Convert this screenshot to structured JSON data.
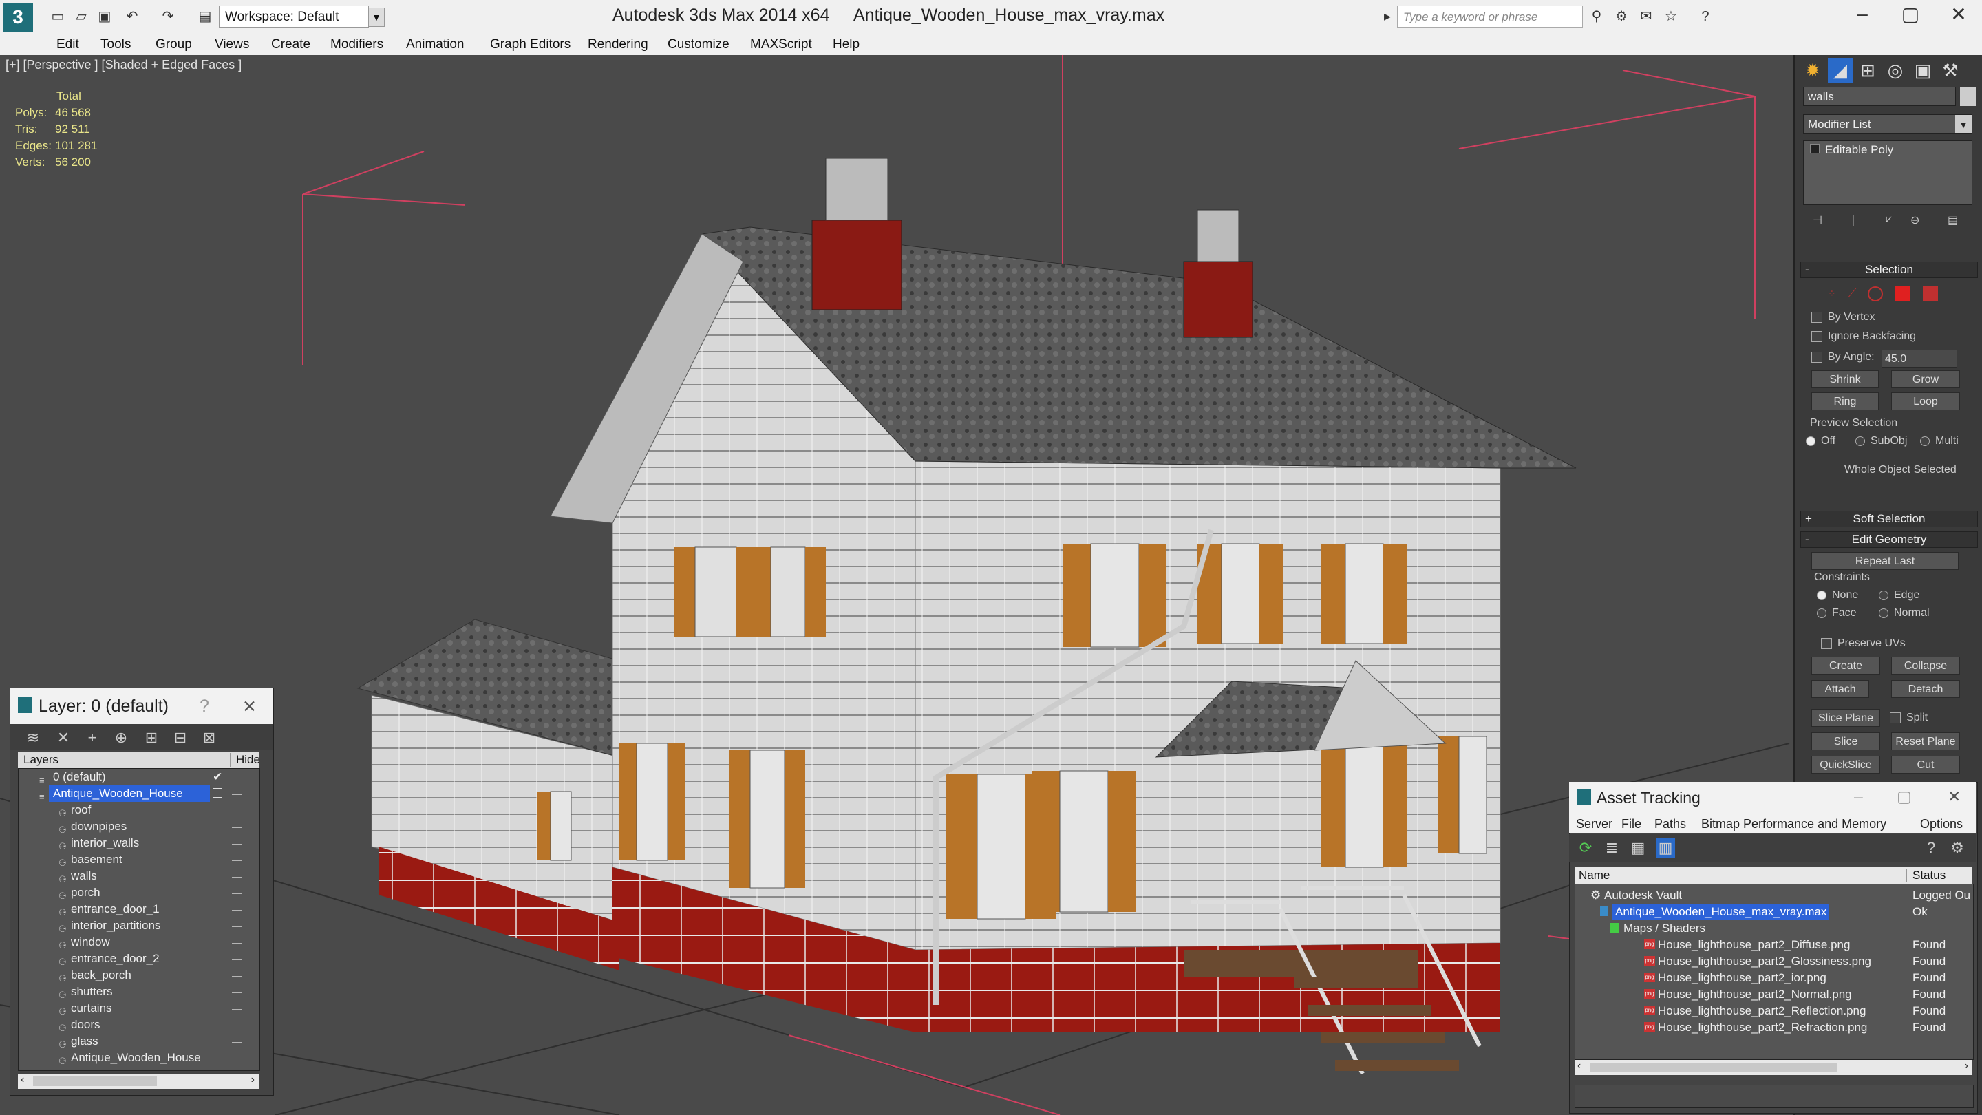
{
  "titlebar": {
    "app": "Autodesk 3ds Max  2014 x64",
    "file": "Antique_Wooden_House_max_vray.max",
    "workspace": "Workspace: Default",
    "search_placeholder": "Type a keyword or phrase"
  },
  "menu": [
    "Edit",
    "Tools",
    "Group",
    "Views",
    "Create",
    "Modifiers",
    "Animation",
    "Graph Editors",
    "Rendering",
    "Customize",
    "MAXScript",
    "Help"
  ],
  "viewport": {
    "label": "[+] [Perspective ] [Shaded + Edged Faces ]",
    "stats": {
      "header": "Total",
      "rows": [
        {
          "k": "Polys:",
          "v": "46 568"
        },
        {
          "k": "Tris:",
          "v": "92 511"
        },
        {
          "k": "Edges:",
          "v": "101 281"
        },
        {
          "k": "Verts:",
          "v": "56 200"
        }
      ]
    }
  },
  "command_panel": {
    "object_name": "walls",
    "modifier_list": "Modifier List",
    "stack_item": "Editable Poly",
    "selection": {
      "title": "Selection",
      "by_vertex": "By Vertex",
      "ignore_backfacing": "Ignore Backfacing",
      "by_angle": "By Angle:",
      "angle_value": "45.0",
      "shrink": "Shrink",
      "grow": "Grow",
      "ring": "Ring",
      "loop": "Loop",
      "preview": "Preview Selection",
      "preview_opts": [
        "Off",
        "SubObj",
        "Multi"
      ],
      "status": "Whole Object Selected"
    },
    "soft_selection": "Soft Selection",
    "edit_geometry": {
      "title": "Edit Geometry",
      "repeat_last": "Repeat Last",
      "constraints": "Constraints",
      "c_none": "None",
      "c_edge": "Edge",
      "c_face": "Face",
      "c_normal": "Normal",
      "preserve_uvs": "Preserve UVs",
      "create": "Create",
      "collapse": "Collapse",
      "attach": "Attach",
      "detach": "Detach",
      "slice_plane": "Slice Plane",
      "split": "Split",
      "slice": "Slice",
      "reset_plane": "Reset Plane",
      "quickslice": "QuickSlice",
      "cut": "Cut"
    }
  },
  "layer_panel": {
    "title": "Layer: 0 (default)",
    "col_layers": "Layers",
    "col_hide": "Hide",
    "rows": [
      {
        "name": "0 (default)",
        "level": 0
      },
      {
        "name": "Antique_Wooden_House",
        "level": 0,
        "selected": true
      },
      {
        "name": "roof",
        "level": 1
      },
      {
        "name": "downpipes",
        "level": 1
      },
      {
        "name": "interior_walls",
        "level": 1
      },
      {
        "name": "basement",
        "level": 1
      },
      {
        "name": "walls",
        "level": 1
      },
      {
        "name": "porch",
        "level": 1
      },
      {
        "name": "entrance_door_1",
        "level": 1
      },
      {
        "name": "interior_partitions",
        "level": 1
      },
      {
        "name": "window",
        "level": 1
      },
      {
        "name": "entrance_door_2",
        "level": 1
      },
      {
        "name": "back_porch",
        "level": 1
      },
      {
        "name": "shutters",
        "level": 1
      },
      {
        "name": "curtains",
        "level": 1
      },
      {
        "name": "doors",
        "level": 1
      },
      {
        "name": "glass",
        "level": 1
      },
      {
        "name": "Antique_Wooden_House",
        "level": 1
      }
    ]
  },
  "asset_tracking": {
    "title": "Asset Tracking",
    "menu": [
      "Server",
      "File",
      "Paths",
      "Bitmap Performance and Memory",
      "Options"
    ],
    "col_name": "Name",
    "col_status": "Status",
    "rows": [
      {
        "name": "Autodesk Vault",
        "status": "Logged Ou",
        "indent": 0
      },
      {
        "name": "Antique_Wooden_House_max_vray.max",
        "status": "Ok",
        "indent": 1,
        "selected": true
      },
      {
        "name": "Maps / Shaders",
        "status": "",
        "indent": 2
      },
      {
        "name": "House_lighthouse_part2_Diffuse.png",
        "status": "Found",
        "indent": 3
      },
      {
        "name": "House_lighthouse_part2_Glossiness.png",
        "status": "Found",
        "indent": 3
      },
      {
        "name": "House_lighthouse_part2_ior.png",
        "status": "Found",
        "indent": 3
      },
      {
        "name": "House_lighthouse_part2_Normal.png",
        "status": "Found",
        "indent": 3
      },
      {
        "name": "House_lighthouse_part2_Reflection.png",
        "status": "Found",
        "indent": 3
      },
      {
        "name": "House_lighthouse_part2_Refraction.png",
        "status": "Found",
        "indent": 3
      }
    ]
  }
}
